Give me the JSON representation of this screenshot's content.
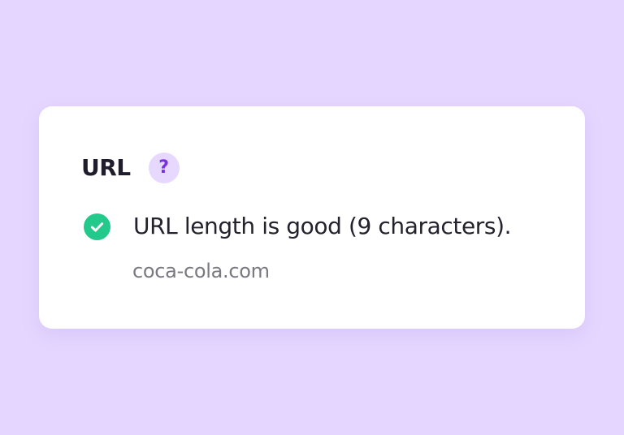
{
  "theme": {
    "background_color": "#e5d6ff",
    "success_color": "#22c98a",
    "help_bg_color": "#e6d8ff",
    "help_fg_color": "#7a2fe0",
    "muted_text_color": "#7a7880"
  },
  "card": {
    "title": "URL",
    "help_icon": "question-mark-icon",
    "help_glyph": "?",
    "result": {
      "status_icon": "check-circle-icon",
      "message": "URL length is good (9 characters).",
      "url": "coca-cola.com"
    }
  }
}
